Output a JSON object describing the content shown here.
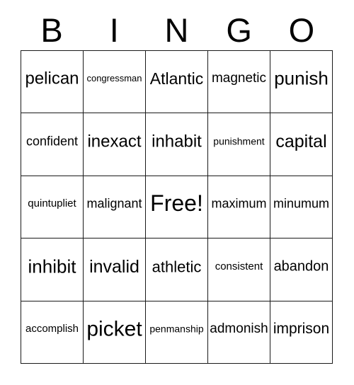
{
  "header": {
    "letters": [
      "B",
      "I",
      "N",
      "G",
      "O"
    ]
  },
  "grid": {
    "rows": [
      [
        {
          "text": "pelican",
          "size": 24
        },
        {
          "text": "congressman",
          "size": 13
        },
        {
          "text": "Atlantic",
          "size": 23
        },
        {
          "text": "magnetic",
          "size": 19
        },
        {
          "text": "punish",
          "size": 26
        }
      ],
      [
        {
          "text": "confident",
          "size": 18
        },
        {
          "text": "inexact",
          "size": 24
        },
        {
          "text": "inhabit",
          "size": 24
        },
        {
          "text": "punishment",
          "size": 14
        },
        {
          "text": "capital",
          "size": 25
        }
      ],
      [
        {
          "text": "quintupliet",
          "size": 15
        },
        {
          "text": "malignant",
          "size": 18
        },
        {
          "text": "Free!",
          "size": 32
        },
        {
          "text": "maximum",
          "size": 18
        },
        {
          "text": "minumum",
          "size": 18
        }
      ],
      [
        {
          "text": "inhibit",
          "size": 26
        },
        {
          "text": "invalid",
          "size": 25
        },
        {
          "text": "athletic",
          "size": 22
        },
        {
          "text": "consistent",
          "size": 15
        },
        {
          "text": "abandon",
          "size": 20
        }
      ],
      [
        {
          "text": "accomplish",
          "size": 15
        },
        {
          "text": "picket",
          "size": 30
        },
        {
          "text": "penmanship",
          "size": 14
        },
        {
          "text": "admonish",
          "size": 19
        },
        {
          "text": "imprison",
          "size": 21
        }
      ]
    ]
  },
  "colors": {
    "border": "#1a1a1a",
    "text": "#000000",
    "background": "#ffffff"
  }
}
